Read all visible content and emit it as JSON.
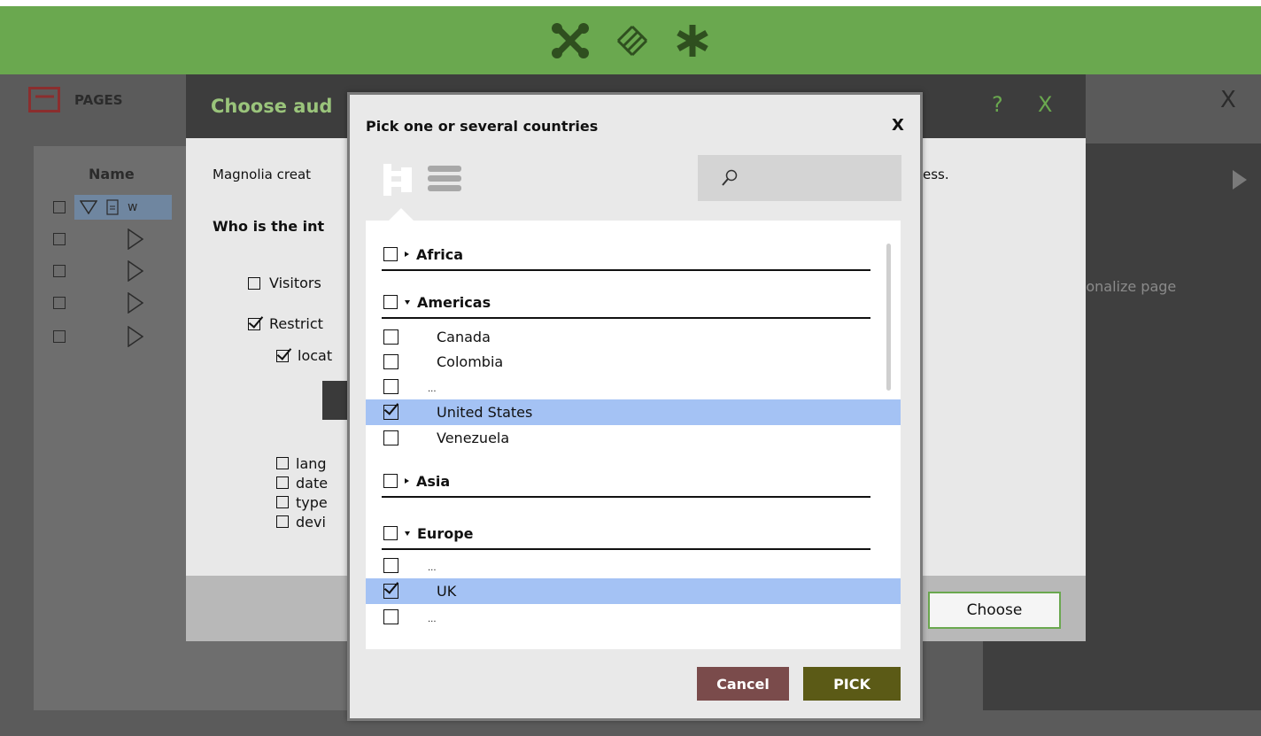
{
  "topbar": {
    "icons": [
      "shuffle-icon",
      "grid-pattern-icon",
      "asterisk-icon"
    ],
    "color": "#6aa84f"
  },
  "pages": {
    "tab_label": "PAGES",
    "column_name": "Name",
    "first_row_label": "w"
  },
  "right_panel": {
    "close_label": "X",
    "text": "sonalize page"
  },
  "audience_dialog": {
    "title": "Choose aud",
    "help_label": "?",
    "close_label": "X",
    "intro_text": "Magnolia creat",
    "intro_text_tail": "ess.",
    "question": "Who is the int",
    "options": {
      "visitors": "Visitors",
      "restrict": "Restrict",
      "location": "locat"
    },
    "sub_options": [
      "lang",
      "date",
      "type",
      "devi"
    ],
    "choose_label": "Choose"
  },
  "picker": {
    "title": "Pick one or several countries",
    "close_label": "X",
    "groups": {
      "africa": "Africa",
      "americas": "Americas",
      "asia": "Asia",
      "europe": "Europe"
    },
    "americas_items": [
      "Canada",
      "Colombia",
      "...",
      "United States",
      "Venezuela"
    ],
    "europe_items": [
      "...",
      "UK",
      "..."
    ],
    "cancel_label": "Cancel",
    "pick_label": "PICK"
  }
}
